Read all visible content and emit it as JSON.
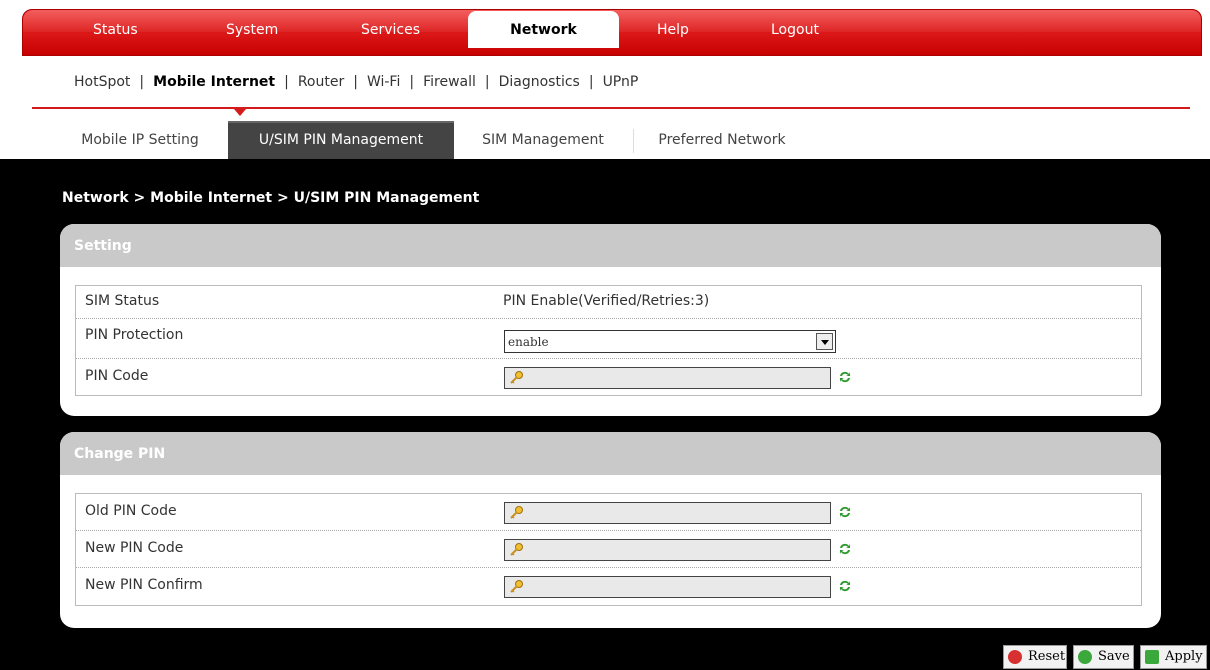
{
  "topnav": [
    {
      "label": "Status"
    },
    {
      "label": "System"
    },
    {
      "label": "Services"
    },
    {
      "label": "Network"
    },
    {
      "label": "Help"
    },
    {
      "label": "Logout"
    }
  ],
  "subnav": [
    {
      "label": "HotSpot"
    },
    {
      "label": "Mobile Internet"
    },
    {
      "label": "Router"
    },
    {
      "label": "Wi-Fi"
    },
    {
      "label": "Firewall"
    },
    {
      "label": "Diagnostics"
    },
    {
      "label": "UPnP"
    }
  ],
  "tabs": [
    {
      "label": "Mobile IP Setting"
    },
    {
      "label": "U/SIM PIN Management"
    },
    {
      "label": "SIM Management"
    },
    {
      "label": "Preferred Network"
    }
  ],
  "breadcrumb": "Network > Mobile Internet > U/SIM PIN Management",
  "setting": {
    "title": "Setting",
    "sim_status_label": "SIM Status",
    "sim_status_value": "PIN Enable(Verified/Retries:3)",
    "pin_protection_label": "PIN Protection",
    "pin_protection_value": "enable",
    "pin_code_label": "PIN Code"
  },
  "change_pin": {
    "title": "Change PIN",
    "old_label": "Old PIN Code",
    "new_label": "New PIN Code",
    "confirm_label": "New PIN Confirm"
  },
  "buttons": {
    "reset": "Reset",
    "save": "Save",
    "apply": "Apply"
  },
  "colors": {
    "brand_red": "#d41b1b",
    "content_bg": "#000000",
    "panel_header": "#c9c9c9"
  }
}
